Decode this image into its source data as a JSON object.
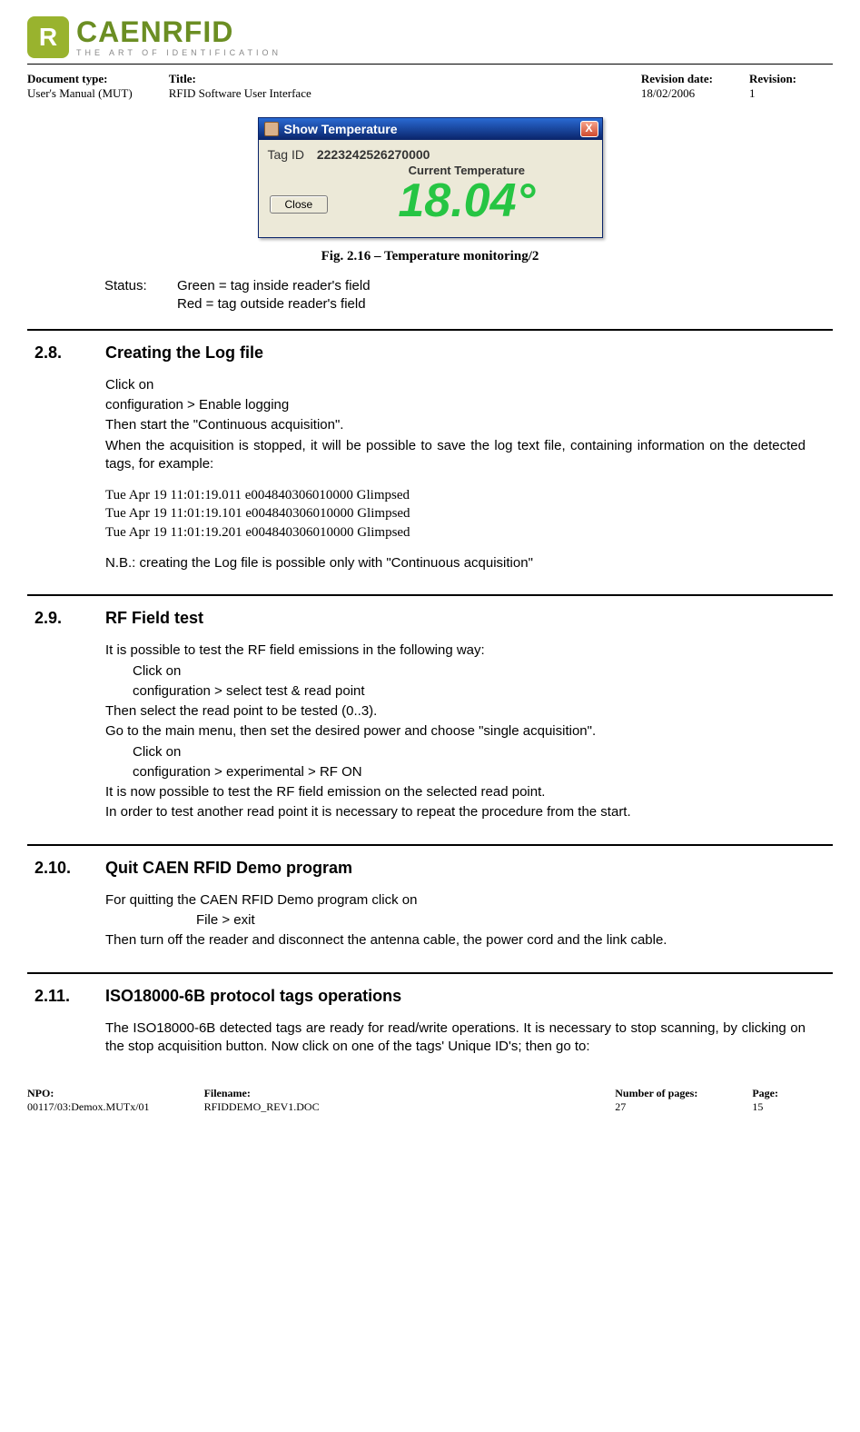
{
  "logo": {
    "icon_letter": "R",
    "main": "CAENRFID",
    "sub": "THE ART OF IDENTIFICATION"
  },
  "meta": {
    "doc_type_label": "Document type:",
    "doc_type_value": "User's Manual (MUT)",
    "title_label": "Title:",
    "title_value": "RFID Software User Interface",
    "rev_date_label": "Revision date:",
    "rev_date_value": "18/02/2006",
    "rev_label": "Revision:",
    "rev_value": "1"
  },
  "dialog": {
    "title": "Show Temperature",
    "close_x": "X",
    "tag_id_label": "Tag ID",
    "tag_id_value": "2223242526270000",
    "close_label": "Close",
    "current_temp_label": "Current Temperature",
    "temp_value": "18.04°"
  },
  "fig_caption": "Fig. 2.16 – Temperature monitoring/2",
  "status": {
    "label": "Status:",
    "green": "Green = tag inside reader's field",
    "red": "Red = tag outside reader's field"
  },
  "sections": {
    "s28": {
      "num": "2.8.",
      "title": "Creating the Log file",
      "p1": "Click on",
      "p2": "configuration > Enable logging",
      "p3": "Then start the \"Continuous acquisition\".",
      "p4": "When the acquisition is stopped, it will be possible to save the log text file, containing information on the detected tags, for example:",
      "log1": "Tue Apr 19 11:01:19.011  e004840306010000  Glimpsed",
      "log2": "Tue Apr 19 11:01:19.101  e004840306010000  Glimpsed",
      "log3": "Tue Apr 19 11:01:19.201  e004840306010000  Glimpsed",
      "nb": "N.B.: creating the Log file is possible only with \"Continuous acquisition\""
    },
    "s29": {
      "num": "2.9.",
      "title": "RF Field test",
      "p1": "It is possible to test the RF field emissions in the following way:",
      "p2": "Click on",
      "p3": "configuration > select test & read point",
      "p4": "Then select the read point to be tested (0..3).",
      "p5": "Go to the main menu, then set the desired power and choose \"single acquisition\".",
      "p6": "Click on",
      "p7": "configuration > experimental > RF ON",
      "p8": "It is now possible to test the RF field emission on the selected read point.",
      "p9": "In order to test another read point it is necessary to repeat the procedure from the start."
    },
    "s210": {
      "num": "2.10.",
      "title": "Quit CAEN RFID Demo program",
      "p1": "For quitting the CAEN RFID Demo program click on",
      "p2": "File > exit",
      "p3": "Then turn off the reader and disconnect the antenna cable, the power cord and the link cable."
    },
    "s211": {
      "num": "2.11.",
      "title": "ISO18000-6B protocol tags operations",
      "p1": "The ISO18000-6B detected tags are ready for read/write operations. It is necessary to stop scanning, by clicking on the stop acquisition button. Now click on one of the tags' Unique ID's; then go to:"
    }
  },
  "footer": {
    "npo_label": "NPO:",
    "npo_value": "00117/03:Demox.MUTx/01",
    "filename_label": "Filename:",
    "filename_value": "RFIDDEMO_REV1.DOC",
    "numpages_label": "Number of pages:",
    "numpages_value": "27",
    "page_label": "Page:",
    "page_value": "15"
  }
}
